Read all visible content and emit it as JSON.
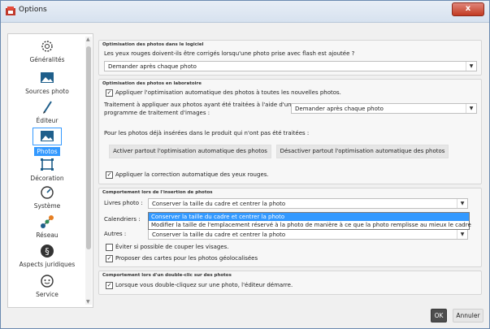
{
  "window": {
    "title": "Options",
    "close_label": "x"
  },
  "sidebar": {
    "items": [
      {
        "label": "Généralités",
        "icon": "gear-icon"
      },
      {
        "label": "Sources photo",
        "icon": "image-icon"
      },
      {
        "label": "Éditeur",
        "icon": "pen-icon"
      },
      {
        "label": "Photos",
        "icon": "photo-icon"
      },
      {
        "label": "Décoration",
        "icon": "crop-frame-icon"
      },
      {
        "label": "Système",
        "icon": "gauge-icon"
      },
      {
        "label": "Réseau",
        "icon": "network-icon"
      },
      {
        "label": "Aspects juridiques",
        "icon": "paragraph-icon"
      },
      {
        "label": "Service",
        "icon": "support-icon"
      }
    ]
  },
  "software_optim": {
    "title": "Optimisation des photos dans le logiciel",
    "question": "Les yeux rouges doivent-ils être corrigés lorsqu'une photo prise avec flash est ajoutée ?",
    "select_value": "Demander après chaque photo"
  },
  "lab_optim": {
    "title": "Optimisation des photos en laboratoire",
    "apply_all_label": "Appliquer l'optimisation automatique des photos à toutes les nouvelles photos.",
    "treat_label_1": "Traitement à appliquer aux photos ayant été traitées à l'aide d'un",
    "treat_label_2": "programme de traitement d'images :",
    "treat_select": "Demander après chaque photo",
    "existing_label": "Pour les photos déjà insérées dans le produit qui n'ont pas été traitées :",
    "activate_btn": "Activer partout l'optimisation automatique des photos",
    "deactivate_btn": "Désactiver partout l'optimisation automatique des photos",
    "red_eye_label": "Appliquer la correction automatique des yeux rouges."
  },
  "insert_behavior": {
    "title": "Comportement lors de l'insertion de photos",
    "books_label": "Livres photo :",
    "books_value": "Conserver la taille du cadre et centrer la photo",
    "calendars_label": "Calendriers :",
    "others_label": "Autres :",
    "others_value": "Conserver la taille du cadre et centrer la photo",
    "avoid_cut_label": "Éviter si possible de couper les visages.",
    "propose_cards_label": "Proposer des cartes pour les photos géolocalisées",
    "dropdown_options": [
      "Conserver la taille du cadre et centrer la photo",
      "Modifier la taille de l'emplacement réservé à la photo de manière à ce que la photo remplisse au mieux le cadre"
    ]
  },
  "double_click": {
    "title": "Comportement lors d'un double-clic sur des photos",
    "label": "Lorsque vous double-cliquez sur une photo, l'éditeur démarre."
  },
  "footer": {
    "ok": "OK",
    "cancel": "Annuler"
  },
  "colors": {
    "accent": "#3399ff",
    "ok_button": "#4d4d4d"
  }
}
